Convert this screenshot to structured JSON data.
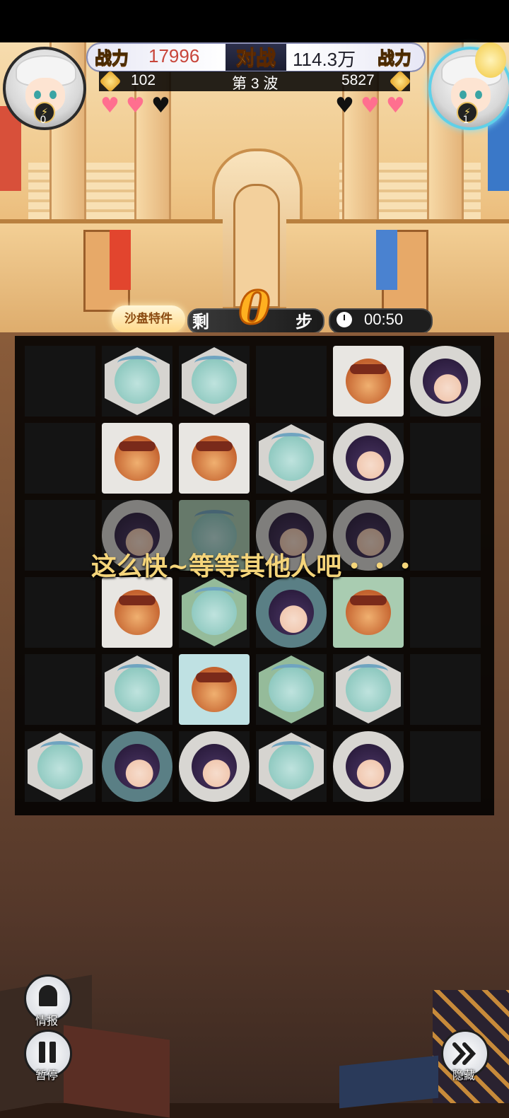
{
  "hud": {
    "left_power_label": "战力",
    "left_power": "17996",
    "vs_label": "对战",
    "right_power": "114.3万",
    "right_power_label": "战力",
    "left_coins": "102",
    "wave": "第 3 波",
    "right_coins": "5827",
    "left_level": "0",
    "right_level": "1",
    "left_hearts": [
      "full",
      "full",
      "empty"
    ],
    "right_hearts": [
      "empty",
      "full",
      "full"
    ]
  },
  "controls": {
    "sandbox_feature": "沙盘特件",
    "steps_prefix": "剩",
    "steps_value": "0",
    "steps_suffix": "步",
    "timer": "00:50"
  },
  "overlay_message": "这么快~等等其他人吧・・・",
  "side_buttons": {
    "intel_label": "情报",
    "pause_label": "暂停",
    "hide_label": "隐藏"
  },
  "colors": {
    "power_left": "#c8453a",
    "power_right": "#1f1f2a",
    "accent_gold": "#f5d57a",
    "heart_full": "#ff6f8f",
    "heart_empty": "#111111"
  },
  "board": {
    "rows": 6,
    "cols": 6,
    "cells": [
      [
        "empty",
        "hex-dog",
        "hex-dog",
        "empty",
        "sq-bull",
        "circ-girl"
      ],
      [
        "empty",
        "sq-bull",
        "sq-bull",
        "hex-dog",
        "circ-girl",
        "empty"
      ],
      [
        "empty",
        "circ-girl-dim",
        "sqg-dog-dim",
        "circg-girl-dim",
        "circg-girl-dim",
        "empty"
      ],
      [
        "empty",
        "sq-bull",
        "hexg-dog",
        "circt-girl",
        "sqg-bull",
        "empty"
      ],
      [
        "empty",
        "hex-dog",
        "sqt-bull",
        "hexg-dog",
        "hex-dog",
        "empty"
      ],
      [
        "hex-dog",
        "circt-girl",
        "circ-girl",
        "hex-dog",
        "circ-girl",
        "empty"
      ]
    ]
  }
}
